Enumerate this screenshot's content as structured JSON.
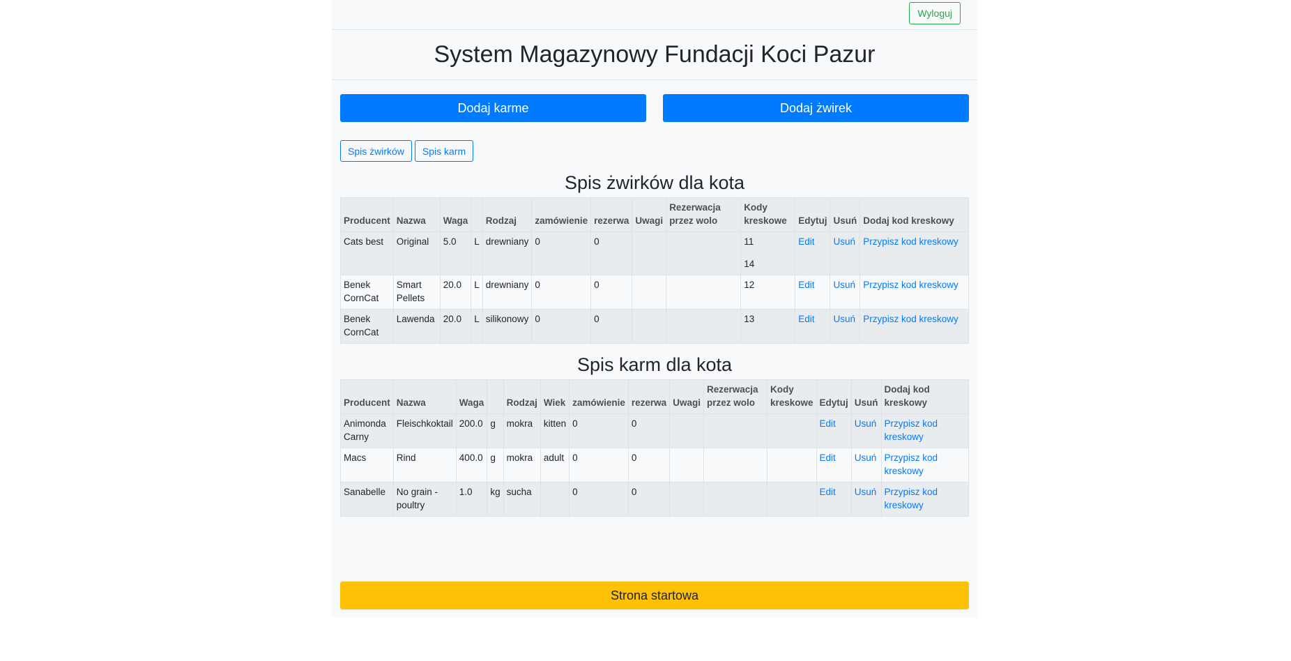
{
  "header": {
    "logout_label": "Wyloguj",
    "title": "System Magazynowy Fundacji Koci Pazur"
  },
  "actions": {
    "add_food_label": "Dodaj karme",
    "add_litter_label": "Dodaj żwirek"
  },
  "filters": {
    "litter_list_label": "Spis żwirków",
    "food_list_label": "Spis karm"
  },
  "litter_table": {
    "title": "Spis żwirków dla kota",
    "headers": [
      "Producent",
      "Nazwa",
      "Waga",
      "",
      "Rodzaj",
      "zamówienie",
      "rezerwa",
      "Uwagi",
      "Rezerwacja przez wolo",
      "Kody kreskowe",
      "Edytuj",
      "Usuń",
      "Dodaj kod kreskowy"
    ],
    "rows": [
      {
        "producer": "Cats best",
        "name": "Original",
        "weight": "5.0",
        "unit": "L",
        "type": "drewniany",
        "order": "0",
        "reserve": "0",
        "notes": "",
        "volunteer": "",
        "codes": [
          "11",
          "14"
        ],
        "edit": "Edit",
        "delete": "Usuń",
        "add_code": "Przypisz kod kreskowy"
      },
      {
        "producer": "Benek CornCat",
        "name": "Smart Pellets",
        "weight": "20.0",
        "unit": "L",
        "type": "drewniany",
        "order": "0",
        "reserve": "0",
        "notes": "",
        "volunteer": "",
        "codes": [
          "12"
        ],
        "edit": "Edit",
        "delete": "Usuń",
        "add_code": "Przypisz kod kreskowy"
      },
      {
        "producer": "Benek CornCat",
        "name": "Lawenda",
        "weight": "20.0",
        "unit": "L",
        "type": "silikonowy",
        "order": "0",
        "reserve": "0",
        "notes": "",
        "volunteer": "",
        "codes": [
          "13"
        ],
        "edit": "Edit",
        "delete": "Usuń",
        "add_code": "Przypisz kod kreskowy"
      }
    ]
  },
  "food_table": {
    "title": "Spis karm dla kota",
    "headers": [
      "Producent",
      "Nazwa",
      "Waga",
      "",
      "Rodzaj",
      "Wiek",
      "zamówienie",
      "rezerwa",
      "Uwagi",
      "Rezerwacja przez wolo",
      "Kody kreskowe",
      "Edytuj",
      "Usuń",
      "Dodaj kod kreskowy"
    ],
    "rows": [
      {
        "producer": "Animonda Carny",
        "name": "Fleischkoktail",
        "weight": "200.0",
        "unit": "g",
        "type": "mokra",
        "age": "kitten",
        "order": "0",
        "reserve": "0",
        "notes": "",
        "volunteer": "",
        "codes": [],
        "edit": "Edit",
        "delete": "Usuń",
        "add_code": "Przypisz kod kreskowy"
      },
      {
        "producer": "Macs",
        "name": "Rind",
        "weight": "400.0",
        "unit": "g",
        "type": "mokra",
        "age": "adult",
        "order": "0",
        "reserve": "0",
        "notes": "",
        "volunteer": "",
        "codes": [],
        "edit": "Edit",
        "delete": "Usuń",
        "add_code": "Przypisz kod kreskowy"
      },
      {
        "producer": "Sanabelle",
        "name": "No grain - poultry",
        "weight": "1.0",
        "unit": "kg",
        "type": "sucha",
        "age": "",
        "order": "0",
        "reserve": "0",
        "notes": "",
        "volunteer": "",
        "codes": [],
        "edit": "Edit",
        "delete": "Usuń",
        "add_code": "Przypisz kod kreskowy"
      }
    ]
  },
  "footer": {
    "home_label": "Strona startowa"
  }
}
